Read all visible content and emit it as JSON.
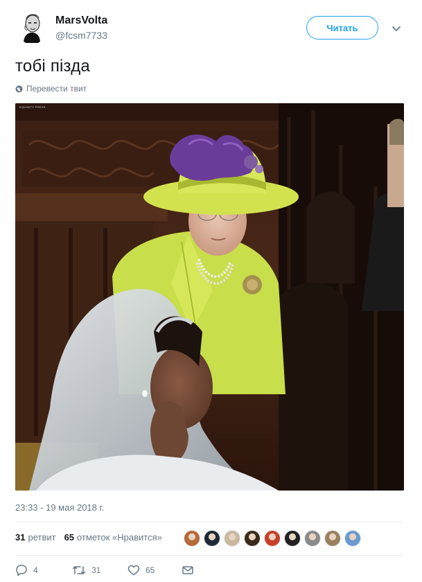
{
  "author": {
    "name": "MarsVolta",
    "handle": "@fcsm7733"
  },
  "follow_label": "Читать",
  "tweet": {
    "text": "тобі пізда",
    "translate_label": "Перевести твит",
    "media_watermark": "EQUINITY PRESS"
  },
  "timestamp": "23:33 - 19 мая 2018 г.",
  "stats": {
    "retweets_count": "31",
    "retweets_label": "ретвит",
    "likes_count": "65",
    "likes_label": "отметок «Нравится»"
  },
  "likers": [
    {
      "color": "#b56a3a"
    },
    {
      "color": "#1e2a38"
    },
    {
      "color": "#c9b8a0"
    },
    {
      "color": "#3a2a1a"
    },
    {
      "color": "#c8402a"
    },
    {
      "color": "#222222"
    },
    {
      "color": "#8a8a8a"
    },
    {
      "color": "#9b8060"
    },
    {
      "color": "#6a9ad0"
    }
  ],
  "actions": {
    "replies": "4",
    "retweets": "31",
    "likes": "65"
  },
  "colors": {
    "accent": "#1da1f2",
    "secondary_text": "#657786",
    "coat": "#c8de4a",
    "feather": "#6a3c9a"
  },
  "icons": [
    "chevron-down-icon",
    "globe-icon",
    "reply-icon",
    "retweet-icon",
    "like-icon",
    "message-icon"
  ]
}
